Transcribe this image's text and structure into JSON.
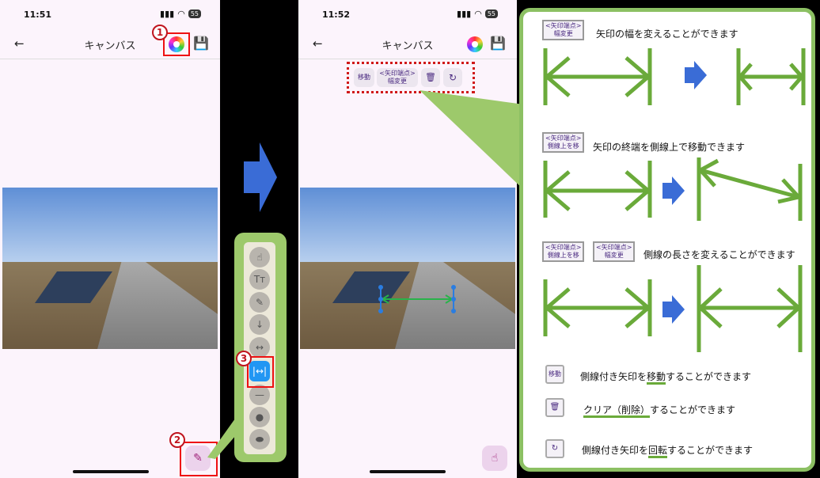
{
  "phone1": {
    "time": "11:51",
    "battery": "55",
    "title": "キャンバス",
    "badge_1": "1",
    "badge_2": "2"
  },
  "phone2": {
    "time": "11:52",
    "battery": "55",
    "title": "キャンバス",
    "ctx": {
      "move_label": "移動",
      "endpoint_width_label": "<矢印端点>\n幅変更",
      "delete_icon": "trash-icon",
      "rotate_icon": "rotate-icon"
    }
  },
  "toolbar": {
    "badge_3": "3",
    "tools": [
      "touch-icon",
      "text-icon",
      "pen-icon",
      "arrow-down-icon",
      "double-arrow-icon",
      "dimension-arrow-icon",
      "line-icon",
      "circle-icon",
      "blob-icon"
    ]
  },
  "info": {
    "row1_tag": "<矢印端点>\n幅変更",
    "row1_text": "矢印の幅を変えることができます",
    "row2_tag": "<矢印端点>\n側線上を移",
    "row2_text": "矢印の終端を側線上で移動できます",
    "row3_tag_a": "<矢印端点>\n側線上を移",
    "row3_tag_b": "<矢印端点>\n幅変更",
    "row3_text": "側線の長さを変えることができます",
    "move_tag": "移動",
    "move_text_a": "側線付き矢印を",
    "move_text_b": "移動",
    "move_text_c": "することができます",
    "clear_text_a": "クリア（削除）",
    "clear_text_b": "することができます",
    "rotate_text_a": "側線付き矢印を",
    "rotate_text_b": "回転",
    "rotate_text_c": "することができます"
  },
  "colors": {
    "accent_green": "#6aaa3a",
    "arrow_blue": "#3a6cd6",
    "red": "#e11111",
    "purple": "#8b21a8"
  }
}
